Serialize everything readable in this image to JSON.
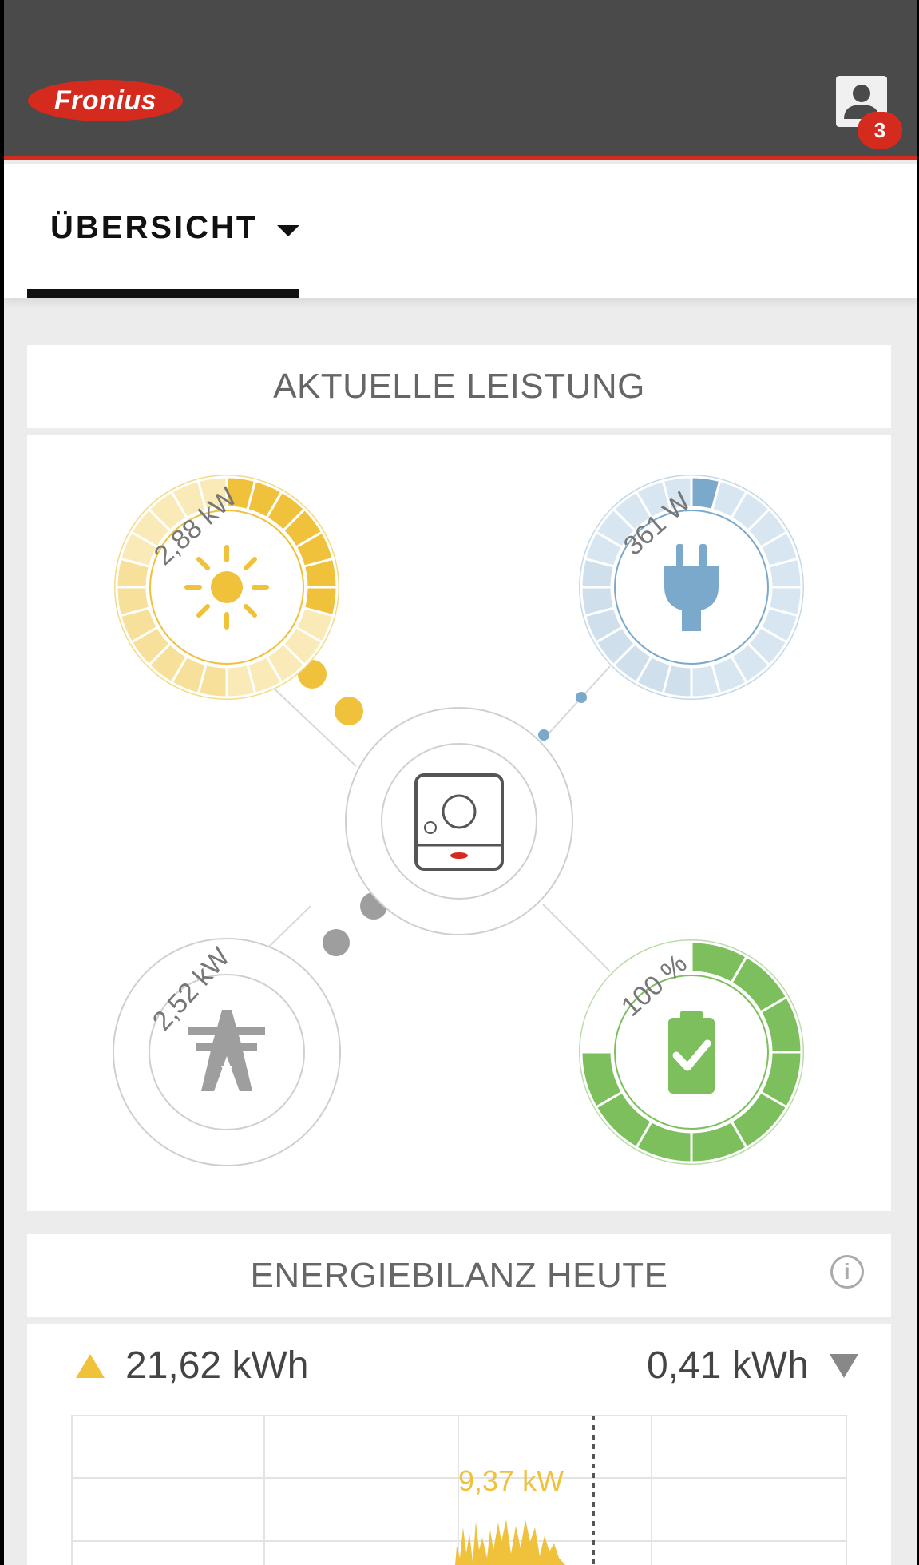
{
  "header": {
    "logo_text": "Fronius",
    "notification_count": "3",
    "brand_color": "#d52b1e"
  },
  "tabs": [
    {
      "label": "ÜBERSICHT",
      "active": true
    }
  ],
  "power_card": {
    "title": "AKTUELLE LEISTUNG",
    "nodes": {
      "pv": {
        "value": "2,88 kW",
        "icon": "sun-icon",
        "color": "#f0c13b",
        "level": 0.28
      },
      "load": {
        "value": "361 W",
        "icon": "plug-icon",
        "color": "#7aa9cb",
        "level": 0.04
      },
      "grid": {
        "value": "2,52 kW",
        "icon": "power-tower-icon",
        "color": "#9e9e9e"
      },
      "battery": {
        "value": "100 %",
        "icon": "battery-check-icon",
        "color": "#7cbf5c",
        "level": 1.0
      },
      "inverter": {
        "icon": "inverter-icon"
      }
    }
  },
  "energy_card": {
    "title": "ENERGIEBILANZ HEUTE",
    "produced": "21,62 kWh",
    "consumed": "0,41 kWh",
    "peak_label": "9,37 kW",
    "produced_color": "#f0c13b"
  }
}
